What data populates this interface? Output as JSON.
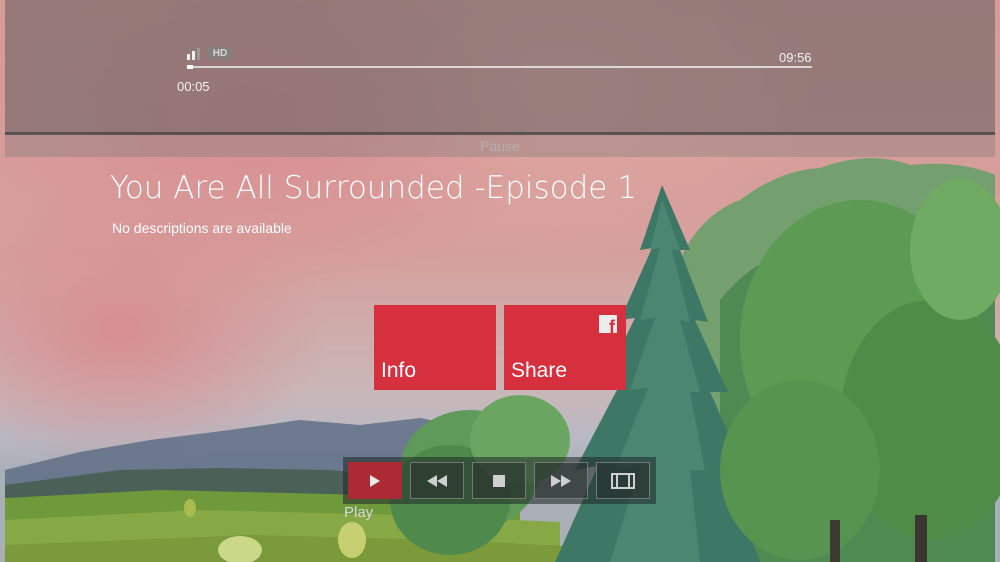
{
  "player": {
    "current_time": "00:05",
    "total_time": "09:56",
    "progress": 0.01,
    "quality_badge": "HD",
    "pause_label": "Pause"
  },
  "episode": {
    "title": "You Are All Surrounded -Episode 1",
    "description": "No descriptions are available"
  },
  "tiles": [
    {
      "label": "Info",
      "icon": null
    },
    {
      "label": "Share",
      "icon": "facebook-icon"
    }
  ],
  "controls": {
    "buttons": [
      {
        "name": "play-button",
        "icon": "play-icon",
        "active": true
      },
      {
        "name": "rewind-button",
        "icon": "rewind-icon",
        "active": false
      },
      {
        "name": "stop-button",
        "icon": "stop-icon",
        "active": false
      },
      {
        "name": "fast-forward-button",
        "icon": "fast-forward-icon",
        "active": false
      },
      {
        "name": "aspect-ratio-button",
        "icon": "film-frame-icon",
        "active": false
      }
    ],
    "focused_label": "Play"
  },
  "colors": {
    "tile_red": "#d6303e",
    "active_control": "#ab2a33"
  }
}
